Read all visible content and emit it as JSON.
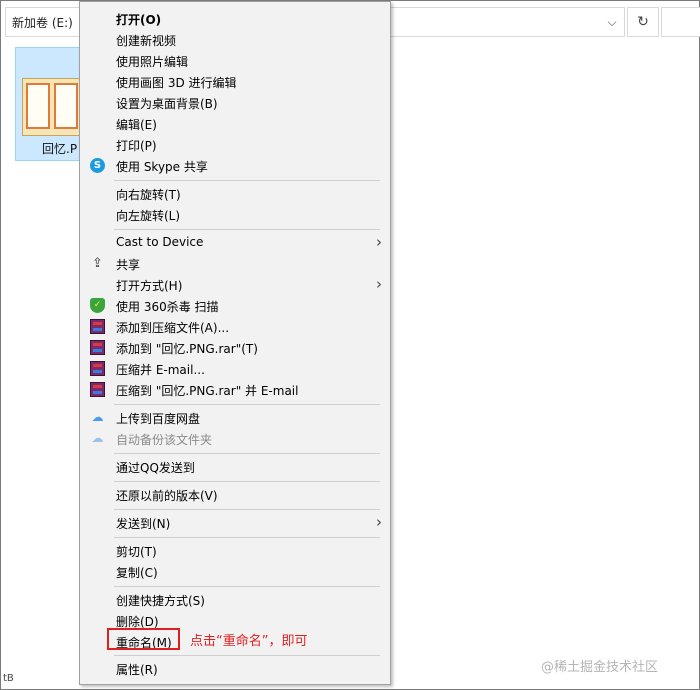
{
  "explorer": {
    "address": "新加卷 (E:)",
    "address_chevron": "⌵",
    "refresh_icon": "↻",
    "file_label": "回忆.P",
    "status_left": "tB"
  },
  "context_menu": {
    "items": [
      {
        "label": "打开(O)"
      },
      {
        "label": "创建新视频"
      },
      {
        "label": "使用照片编辑"
      },
      {
        "label": "使用画图 3D 进行编辑"
      },
      {
        "label": "设置为桌面背景(B)"
      },
      {
        "label": "编辑(E)"
      },
      {
        "label": "打印(P)"
      },
      {
        "label": "使用 Skype 共享",
        "icon": "skype-icon"
      },
      {
        "label": "向右旋转(T)"
      },
      {
        "label": "向左旋转(L)"
      },
      {
        "label": "Cast to Device"
      },
      {
        "label": "共享",
        "icon": "share-icon"
      },
      {
        "label": "打开方式(H)"
      },
      {
        "label": "使用 360杀毒 扫描",
        "icon": "shield-icon"
      },
      {
        "label": "添加到压缩文件(A)...",
        "icon": "rar-icon"
      },
      {
        "label": "添加到 \"回忆.PNG.rar\"(T)",
        "icon": "rar-icon"
      },
      {
        "label": "压缩并 E-mail...",
        "icon": "rar-icon"
      },
      {
        "label": "压缩到 \"回忆.PNG.rar\" 并 E-mail",
        "icon": "rar-icon"
      },
      {
        "label": "上传到百度网盘",
        "icon": "cloud-icon"
      },
      {
        "label": "自动备份该文件夹",
        "icon": "cloud-icon"
      },
      {
        "label": "通过QQ发送到"
      },
      {
        "label": "还原以前的版本(V)"
      },
      {
        "label": "发送到(N)"
      },
      {
        "label": "剪切(T)"
      },
      {
        "label": "复制(C)"
      },
      {
        "label": "创建快捷方式(S)"
      },
      {
        "label": "删除(D)"
      },
      {
        "label": "重命名(M)"
      },
      {
        "label": "属性(R)"
      }
    ],
    "submenu_arrow": "›",
    "skype_glyph": "S",
    "share_glyph": "⇪",
    "shield_glyph": "✓",
    "cloud_glyph": "☁"
  },
  "annotation": {
    "text": "点击“重命名”，即可",
    "color": "#e02020"
  },
  "watermark": "@稀土掘金技术社区"
}
